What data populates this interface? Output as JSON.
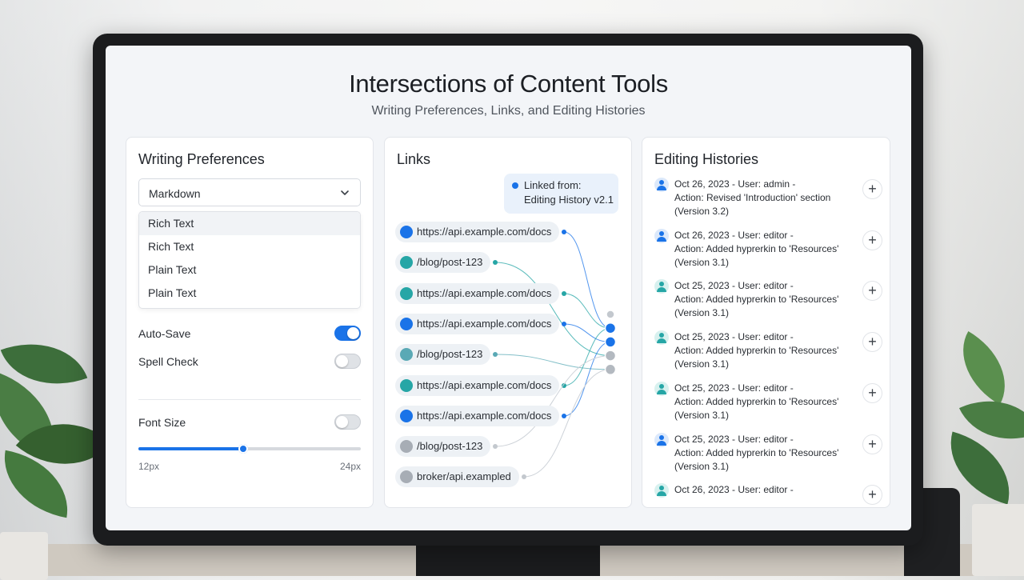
{
  "title": "Intersections of Content Tools",
  "subtitle": "Writing Preferences, Links, and Editing Histories",
  "writing_preferences": {
    "title": "Writing Preferences",
    "select_value": "Markdown",
    "options": [
      "Rich Text",
      "Rich Text",
      "Plain Text",
      "Plain Text"
    ],
    "highlighted_option_index": 0,
    "toggles": [
      {
        "label": "Auto-Save",
        "on": true
      },
      {
        "label": "Spell Check",
        "on": false
      }
    ],
    "font_size": {
      "label": "Font Size",
      "toggle_on": false,
      "min_label": "12px",
      "max_label": "24px",
      "value_fraction": 0.47
    }
  },
  "links": {
    "title": "Links",
    "callout": {
      "line1": "Linked from:",
      "line2": "Editing History v2.1"
    },
    "items": [
      {
        "text": "https://api.example.com/docs",
        "color": "#1a73e8"
      },
      {
        "text": "/blog/post-123",
        "color": "#26a6a6"
      },
      {
        "text": "https://api.example.com/docs",
        "color": "#26a6a6"
      },
      {
        "text": "https://api.example.com/docs",
        "color": "#1a73e8"
      },
      {
        "text": "/blog/post-123",
        "color": "#5aa9b5"
      },
      {
        "text": "https://api.example.com/docs",
        "color": "#26a6a6"
      },
      {
        "text": "https://api.example.com/docs",
        "color": "#1a73e8"
      },
      {
        "text": "/blog/post-123",
        "color": "#a7adb5"
      },
      {
        "text": "broker/api.exampled",
        "color": "#a7adb5"
      }
    ],
    "nodes": [
      {
        "color": "#c3c8ce"
      },
      {
        "color": "#1a73e8"
      },
      {
        "color": "#1a73e8"
      },
      {
        "color": "#b3b9c0"
      },
      {
        "color": "#b3b9c0"
      }
    ]
  },
  "editing_histories": {
    "title": "Editing Histories",
    "items": [
      {
        "line1": "Oct 26, 2023 - User: admin -",
        "line2": "Action: Revised 'Introduction' section",
        "line3": "(Version 3.2)",
        "icon_color": "#1a73e8"
      },
      {
        "line1": "Oct 26, 2023 - User: editor -",
        "line2": "Action: Added hyprerkin to 'Resources'",
        "line3": "(Version 3.1)",
        "icon_color": "#1a73e8"
      },
      {
        "line1": "Oct 25, 2023 - User: editor -",
        "line2": "Action: Added hyprerkin to 'Resources'",
        "line3": "(Version 3.1)",
        "icon_color": "#26a6a6"
      },
      {
        "line1": "Oct 25, 2023 - User: editor -",
        "line2": "Action: Added hyprerkin to 'Resources'",
        "line3": "(Version 3.1)",
        "icon_color": "#26a6a6"
      },
      {
        "line1": "Oct 25, 2023 - User: editor -",
        "line2": "Action: Added hyprerkin to 'Resources'",
        "line3": "(Version 3.1)",
        "icon_color": "#26a6a6"
      },
      {
        "line1": "Oct 25, 2023 - User: editor -",
        "line2": "Action: Added hyprerkin to 'Resources'",
        "line3": "(Version 3.1)",
        "icon_color": "#1a73e8"
      },
      {
        "line1": "Oct 26, 2023 - User: editor -",
        "line2": "",
        "line3": "",
        "icon_color": "#26a6a6"
      }
    ],
    "add_symbol": "+"
  }
}
